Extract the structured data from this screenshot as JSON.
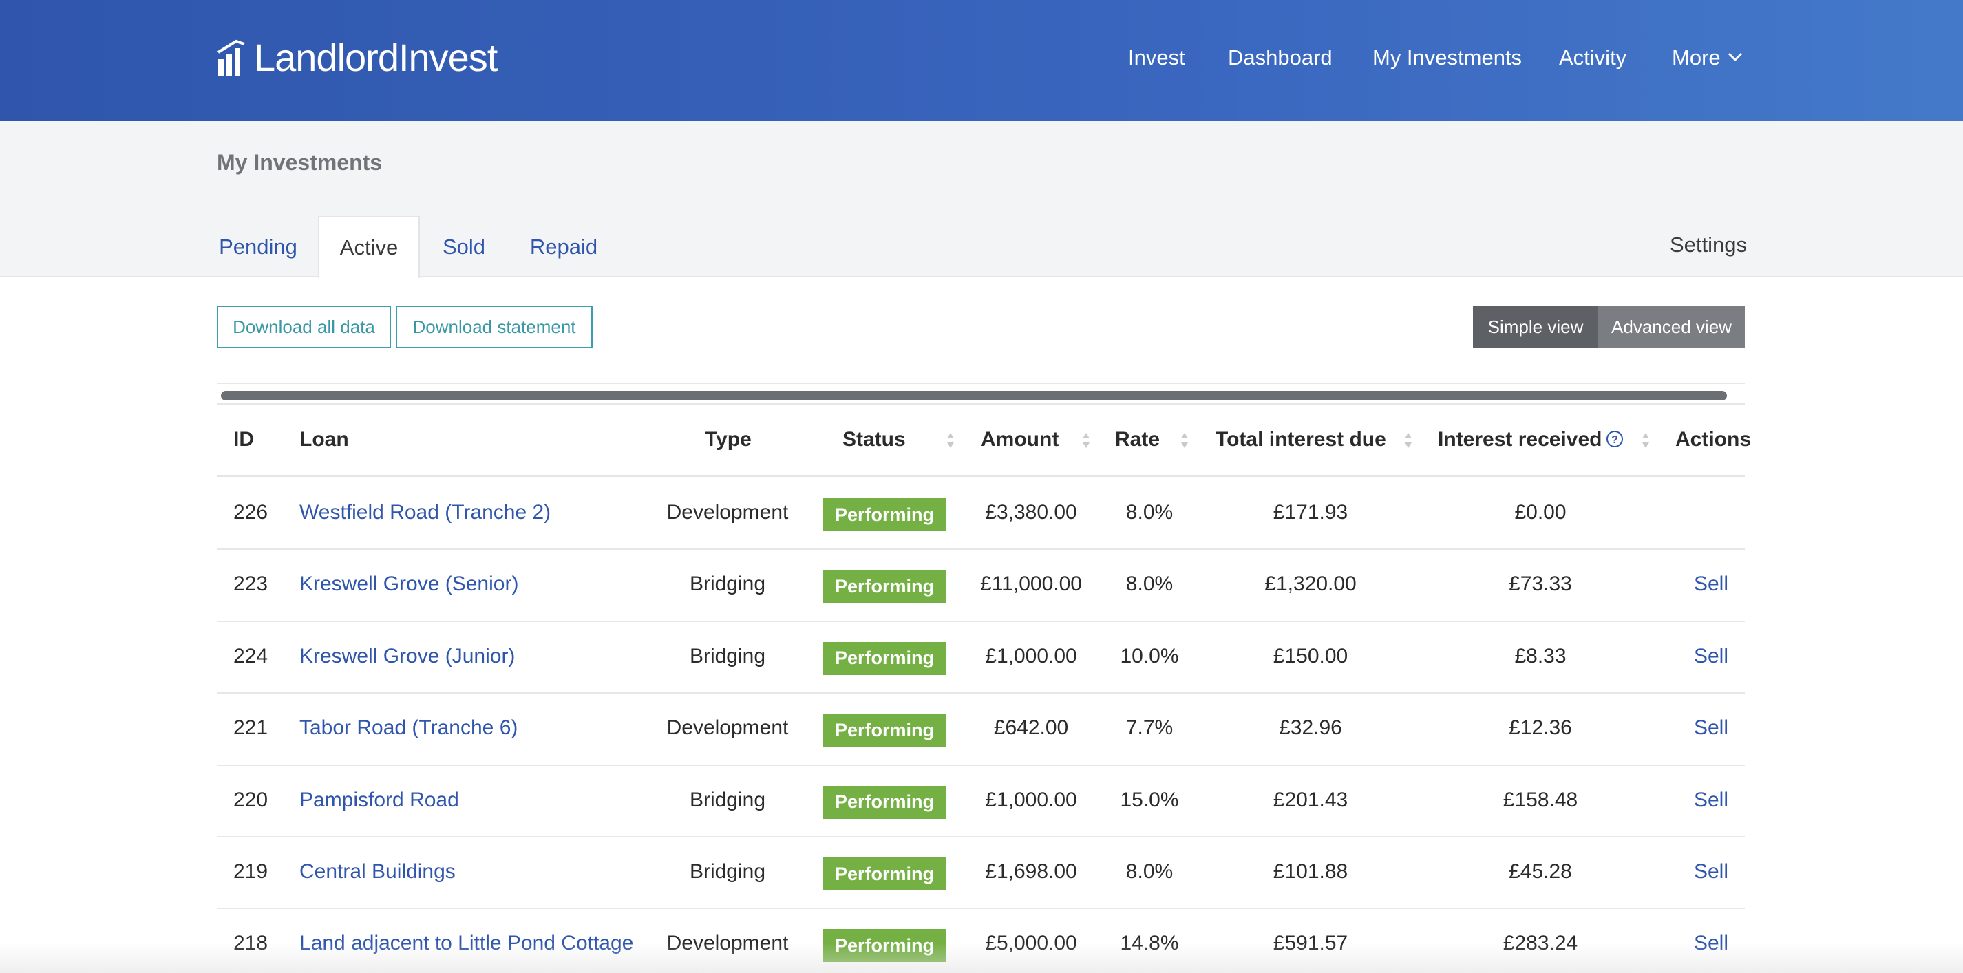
{
  "brand": {
    "logo_text": "LandlordInvest"
  },
  "nav": {
    "items": [
      {
        "label": "Invest"
      },
      {
        "label": "Dashboard"
      },
      {
        "label": "My Investments"
      },
      {
        "label": "Activity"
      },
      {
        "label": "More"
      }
    ]
  },
  "page": {
    "title": "My Investments"
  },
  "tabs": [
    {
      "label": "Pending",
      "active": false
    },
    {
      "label": "Active",
      "active": true
    },
    {
      "label": "Sold",
      "active": false
    },
    {
      "label": "Repaid",
      "active": false
    }
  ],
  "settings_label": "Settings",
  "buttons": {
    "download_all": "Download all data",
    "download_statement": "Download statement",
    "simple_view": "Simple view",
    "advanced_view": "Advanced view"
  },
  "table": {
    "headers": {
      "id": "ID",
      "loan": "Loan",
      "type": "Type",
      "status": "Status",
      "amount": "Amount",
      "rate": "Rate",
      "total_interest_due": "Total interest due",
      "interest_received": "Interest received",
      "actions": "Actions"
    },
    "rows": [
      {
        "id": "226",
        "loan": "Westfield Road (Tranche 2)",
        "type": "Development",
        "status": "Performing",
        "amount": "£3,380.00",
        "rate": "8.0%",
        "total_interest_due": "£171.93",
        "interest_received": "£0.00",
        "action": ""
      },
      {
        "id": "223",
        "loan": "Kreswell Grove (Senior)",
        "type": "Bridging",
        "status": "Performing",
        "amount": "£11,000.00",
        "rate": "8.0%",
        "total_interest_due": "£1,320.00",
        "interest_received": "£73.33",
        "action": "Sell"
      },
      {
        "id": "224",
        "loan": "Kreswell Grove (Junior)",
        "type": "Bridging",
        "status": "Performing",
        "amount": "£1,000.00",
        "rate": "10.0%",
        "total_interest_due": "£150.00",
        "interest_received": "£8.33",
        "action": "Sell"
      },
      {
        "id": "221",
        "loan": "Tabor Road (Tranche 6)",
        "type": "Development",
        "status": "Performing",
        "amount": "£642.00",
        "rate": "7.7%",
        "total_interest_due": "£32.96",
        "interest_received": "£12.36",
        "action": "Sell"
      },
      {
        "id": "220",
        "loan": "Pampisford Road",
        "type": "Bridging",
        "status": "Performing",
        "amount": "£1,000.00",
        "rate": "15.0%",
        "total_interest_due": "£201.43",
        "interest_received": "£158.48",
        "action": "Sell"
      },
      {
        "id": "219",
        "loan": "Central Buildings",
        "type": "Bridging",
        "status": "Performing",
        "amount": "£1,698.00",
        "rate": "8.0%",
        "total_interest_due": "£101.88",
        "interest_received": "£45.28",
        "action": "Sell"
      },
      {
        "id": "218",
        "loan": "Land adjacent to Little Pond Cottage",
        "type": "Development",
        "status": "Performing",
        "amount": "£5,000.00",
        "rate": "14.8%",
        "total_interest_due": "£591.57",
        "interest_received": "£283.24",
        "action": "Sell"
      }
    ]
  },
  "colors": {
    "header_blue": "#2f56ac",
    "status_green": "#74b043",
    "link_blue": "#2f56ac",
    "button_teal": "#3aa0ad"
  },
  "icons": {
    "logo": "bar-chart-icon",
    "more": "chevron-down-icon",
    "help": "question-circle-icon",
    "sort": "sort-arrows-icon"
  }
}
